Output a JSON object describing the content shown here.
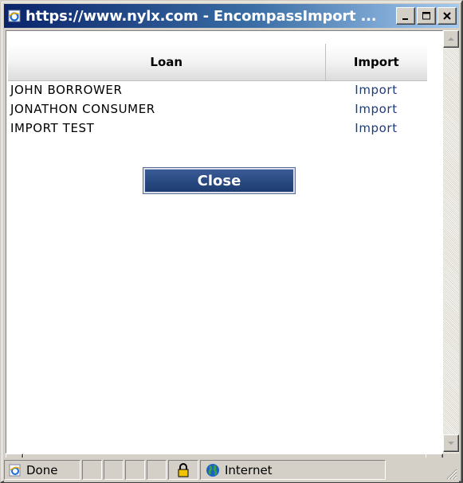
{
  "window": {
    "title": "https://www.nylx.com - EncompassImport ..."
  },
  "table": {
    "headers": {
      "loan": "Loan",
      "import": "Import"
    },
    "rows": [
      {
        "loan": "JOHN BORROWER",
        "action": "Import"
      },
      {
        "loan": "JONATHON CONSUMER",
        "action": "Import"
      },
      {
        "loan": "IMPORT TEST",
        "action": "Import"
      }
    ]
  },
  "close_button": {
    "label": "Close"
  },
  "statusbar": {
    "status": "Done",
    "zone": "Internet"
  },
  "colors": {
    "titlebar": "#0a246a",
    "link": "#1c3c80",
    "button": "#27487f"
  },
  "icons": [
    "ie-page-icon",
    "minimize-icon",
    "maximize-icon",
    "close-icon",
    "lock-icon",
    "globe-icon",
    "scroll-up-icon",
    "scroll-down-icon",
    "scroll-left-icon",
    "scroll-right-icon",
    "resize-grip-icon"
  ]
}
